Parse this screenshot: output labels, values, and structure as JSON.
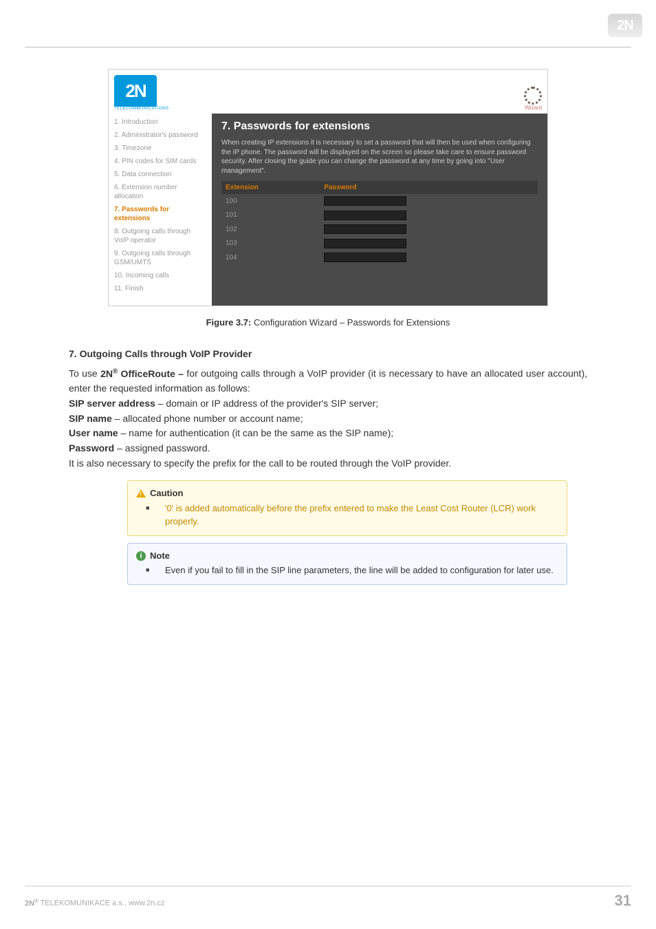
{
  "header_logo_text": "2N",
  "figure": {
    "brand_text": "2N",
    "brand_sub": "TELECOMMUNICATIONS",
    "wizard_label": "Wizard",
    "nav": [
      "1. Introduction",
      "2. Administrator's password",
      "3. Timezone",
      "4. PIN codes for SIM cards",
      "5. Data connection",
      "6. Extension number allocation",
      "7. Passwords for extensions",
      "8. Outgoing calls through VoIP operator",
      "9. Outgoing calls through GSM/UMTS",
      "10. Incoming calls",
      "11. Finish"
    ],
    "nav_active_index": 6,
    "title": "7. Passwords for extensions",
    "intro": "When creating IP extensions it is necessary to set a password that will then be used when configuring the IP phone. The password will be displayed on the screen so please take care to ensure password security. After closing the guide you can change the password at any time by going into \"User management\".",
    "table": {
      "col_ext": "Extension",
      "col_pwd": "Password",
      "rows": [
        "100",
        "101",
        "102",
        "103",
        "104"
      ]
    }
  },
  "caption_label": "Figure 3.7:",
  "caption_text": " Configuration Wizard – Passwords for Extensions",
  "section_heading": "7. Outgoing Calls through VoIP Provider",
  "p1_pre": "To use ",
  "p1_brand": "2N",
  "p1_brand_suffix": " OfficeRoute –",
  "p1_post": " for outgoing calls through a VoIP provider (it is necessary to have an allocated user account), enter the requested information as follows:",
  "sip_server_b": "SIP server address",
  "sip_server_t": " – domain or IP address of the provider's SIP server;",
  "sip_name_b": "SIP name",
  "sip_name_t": " – allocated phone number or account name;",
  "user_name_b": "User name",
  "user_name_t": " – name for authentication (it can be the same as the SIP name);",
  "password_b": "Password",
  "password_t": " – assigned password.",
  "p2": "It is also necessary to specify the prefix for the call to be routed through the VoIP provider.",
  "caution_head": "Caution",
  "caution_body": "'0' is added automatically before the prefix entered to make the Least Cost Router (LCR) work properly.",
  "note_head": "Note",
  "note_body": "Even if you fail to fill in the SIP line parameters, the line will be added to configuration for later use.",
  "footer_company_pre": "2N",
  "footer_company_post": " TELEKOMUNIKACE a.s., www.2n.cz",
  "page_number": "31",
  "chart_data": {
    "type": "table",
    "title": "7. Passwords for extensions",
    "columns": [
      "Extension",
      "Password"
    ],
    "rows": [
      [
        "100",
        ""
      ],
      [
        "101",
        ""
      ],
      [
        "102",
        ""
      ],
      [
        "103",
        ""
      ],
      [
        "104",
        ""
      ]
    ]
  }
}
